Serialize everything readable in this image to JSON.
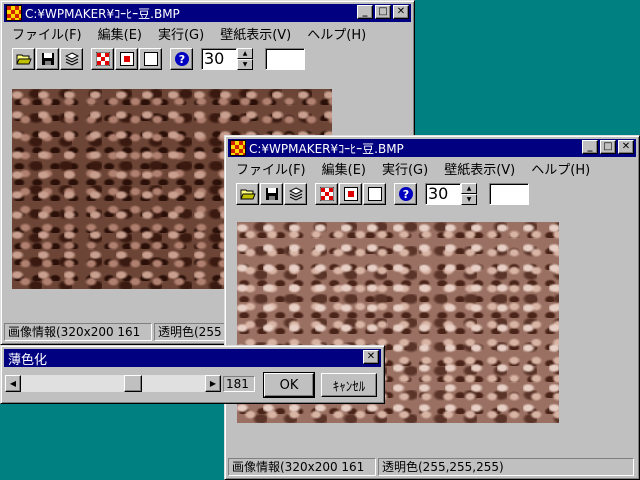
{
  "back_window": {
    "title": "C:¥WPMAKER¥ｺｰﾋｰ豆.BMP",
    "menu": [
      "ファイル(F)",
      "編集(E)",
      "実行(G)",
      "壁紙表示(V)",
      "ヘルプ(H)"
    ],
    "spin_value": "30",
    "status": [
      "画像情報(320x200 161",
      "透明色(255"
    ]
  },
  "front_window": {
    "title": "C:¥WPMAKER¥ｺｰﾋｰ豆.BMP",
    "menu": [
      "ファイル(F)",
      "編集(E)",
      "実行(G)",
      "壁紙表示(V)",
      "ヘルプ(H)"
    ],
    "spin_value": "30",
    "status": [
      "画像情報(320x200 161",
      "透明色(255,255,255)"
    ]
  },
  "dialog": {
    "title": "薄色化",
    "slider_value": "181",
    "slider_fraction": 0.62,
    "ok_label": "OK",
    "cancel_label": "ｷｬﾝｾﾙ"
  },
  "icons": {
    "minimize": "minimize-icon",
    "maximize": "maximize-icon",
    "close": "close-icon",
    "toolbar": [
      "open-folder-icon",
      "save-disk-icon",
      "stack-icon",
      "checker-icon",
      "red-square-icon",
      "white-square-icon",
      "help-icon"
    ]
  },
  "colors": {
    "titlebar": "#000080",
    "desktop": "#008080",
    "face": "#c0c0c0"
  }
}
